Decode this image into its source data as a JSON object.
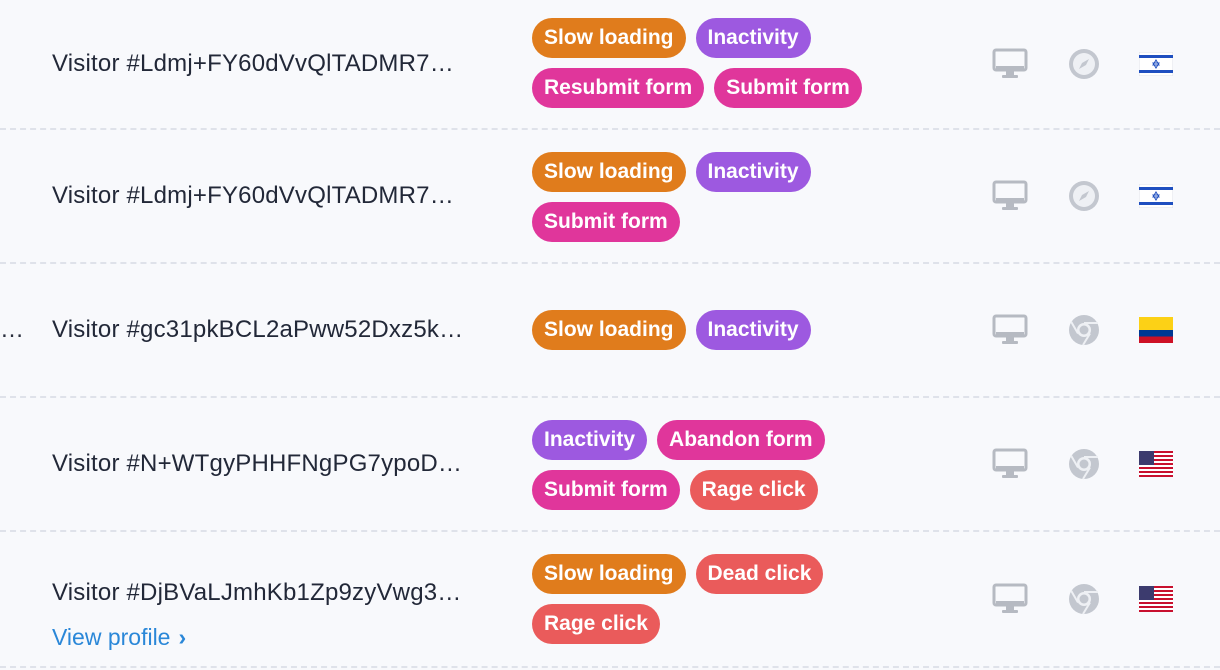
{
  "colors": {
    "slow_loading": "#e07c1c",
    "inactivity": "#9d59e0",
    "resubmit_form": "#e0369b",
    "submit_form": "#e0369b",
    "abandon_form": "#e0369b",
    "rage_click": "#ea5b5b",
    "dead_click": "#ea5b5b",
    "link": "#2a87d8",
    "icon_gray": "#c0c4cc"
  },
  "rows": [
    {
      "visitor": "Visitor #Ldmj+FY60dVvQlTADMR7…",
      "tags": [
        "Slow loading",
        "Inactivity",
        "Resubmit form",
        "Submit form"
      ],
      "device": "desktop-icon",
      "browser": "safari-icon",
      "flag": "israel-flag-icon"
    },
    {
      "visitor": "Visitor #Ldmj+FY60dVvQlTADMR7…",
      "tags": [
        "Slow loading",
        "Inactivity",
        "Submit form"
      ],
      "device": "desktop-icon",
      "browser": "safari-icon",
      "flag": "israel-flag-icon"
    },
    {
      "left_ellipsis": "…",
      "visitor": "Visitor #gc31pkBCL2aPww52Dxz5k…",
      "tags": [
        "Slow loading",
        "Inactivity"
      ],
      "device": "desktop-icon",
      "browser": "chrome-icon",
      "flag": "colombia-flag-icon"
    },
    {
      "visitor": "Visitor #N+WTgyPHHFNgPG7ypoD…",
      "tags": [
        "Inactivity",
        "Abandon form",
        "Submit form",
        "Rage click"
      ],
      "device": "desktop-icon",
      "browser": "chrome-icon",
      "flag": "usa-flag-icon"
    },
    {
      "visitor": "Visitor #DjBVaLJmhKb1Zp9zyVwg3…",
      "view_profile": "View profile",
      "tags": [
        "Slow loading",
        "Dead click",
        "Rage click"
      ],
      "device": "desktop-icon",
      "browser": "chrome-icon",
      "flag": "usa-flag-icon"
    }
  ]
}
